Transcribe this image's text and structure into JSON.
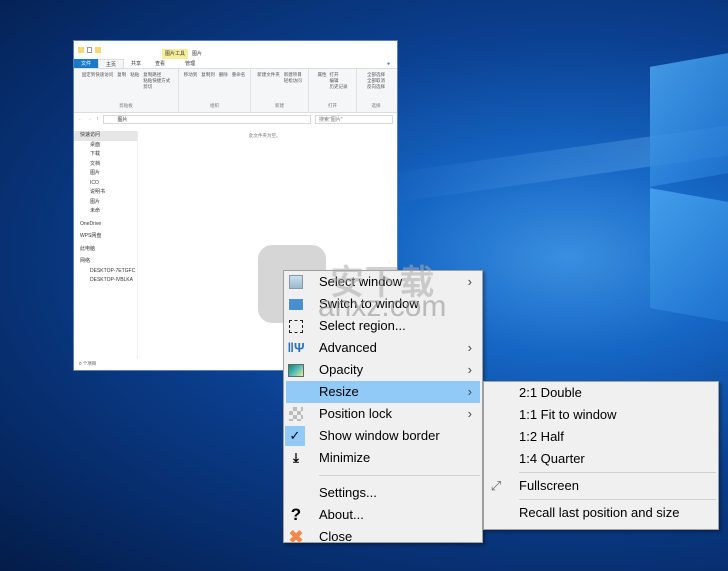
{
  "explorer": {
    "title": "图片",
    "context_tab": "图片工具",
    "tabs": [
      "文件",
      "主页",
      "共享",
      "查看",
      "管理"
    ],
    "ribbon_groups": [
      {
        "label": "剪贴板",
        "items": [
          "固定到快速访问",
          "复制",
          "粘贴",
          "复制路径",
          "粘贴快捷方式",
          "剪切"
        ]
      },
      {
        "label": "组织",
        "items": [
          "移动到",
          "复制到",
          "删除",
          "重命名"
        ]
      },
      {
        "label": "新建",
        "items": [
          "新建文件夹",
          "新建项目",
          "轻松访问"
        ]
      },
      {
        "label": "打开",
        "items": [
          "属性",
          "打开",
          "编辑",
          "历史记录"
        ]
      },
      {
        "label": "选择",
        "items": [
          "全部选择",
          "全部取消",
          "反向选择"
        ]
      }
    ],
    "address": "图片",
    "search_placeholder": "搜索\"图片\"",
    "nav": {
      "quick_access": "快速访问",
      "items": [
        "桌面",
        "下载",
        "文档",
        "图片",
        "ICO",
        "说明书",
        "图片",
        "未命"
      ],
      "onedrive": "OneDrive",
      "wps": "WPS网盘",
      "this_pc": "此电脑",
      "network": "网络",
      "computers": [
        "DESKTOP-7ETGFC",
        "DESKTOP-IVBLKA"
      ]
    },
    "empty_text": "此文件夹为空。",
    "status": "0 个项目"
  },
  "watermark": {
    "text": "安下载",
    "url": "anxz.com"
  },
  "context_menu": {
    "items": [
      {
        "label": "Select window",
        "icon": "window-list-icon",
        "submenu": true
      },
      {
        "label": "Switch to window",
        "icon": "switch-window-icon",
        "submenu": false
      },
      {
        "label": "Select region...",
        "icon": "dashed-region-icon",
        "submenu": false
      },
      {
        "label": "Advanced",
        "icon": "tools-icon",
        "submenu": true
      },
      {
        "label": "Opacity",
        "icon": "opacity-icon",
        "submenu": true
      },
      {
        "label": "Resize",
        "icon": "",
        "submenu": true,
        "highlighted": true
      },
      {
        "label": "Position lock",
        "icon": "grid-icon",
        "submenu": true
      },
      {
        "label": "Show window border",
        "icon": "check-icon",
        "checked": true
      },
      {
        "label": "Minimize",
        "icon": "minimize-icon"
      },
      {
        "label": "Settings...",
        "icon": ""
      },
      {
        "label": "About...",
        "icon": "question-icon"
      },
      {
        "label": "Close",
        "icon": "close-x-icon"
      }
    ]
  },
  "resize_menu": {
    "items": [
      "2:1 Double",
      "1:1 Fit to window",
      "1:2 Half",
      "1:4 Quarter",
      "Fullscreen",
      "Recall last position and size"
    ]
  },
  "colors": {
    "highlight": "#91c9f7",
    "menu_bg": "#f0f0f0",
    "ribbon_file_tab": "#1979ca"
  }
}
